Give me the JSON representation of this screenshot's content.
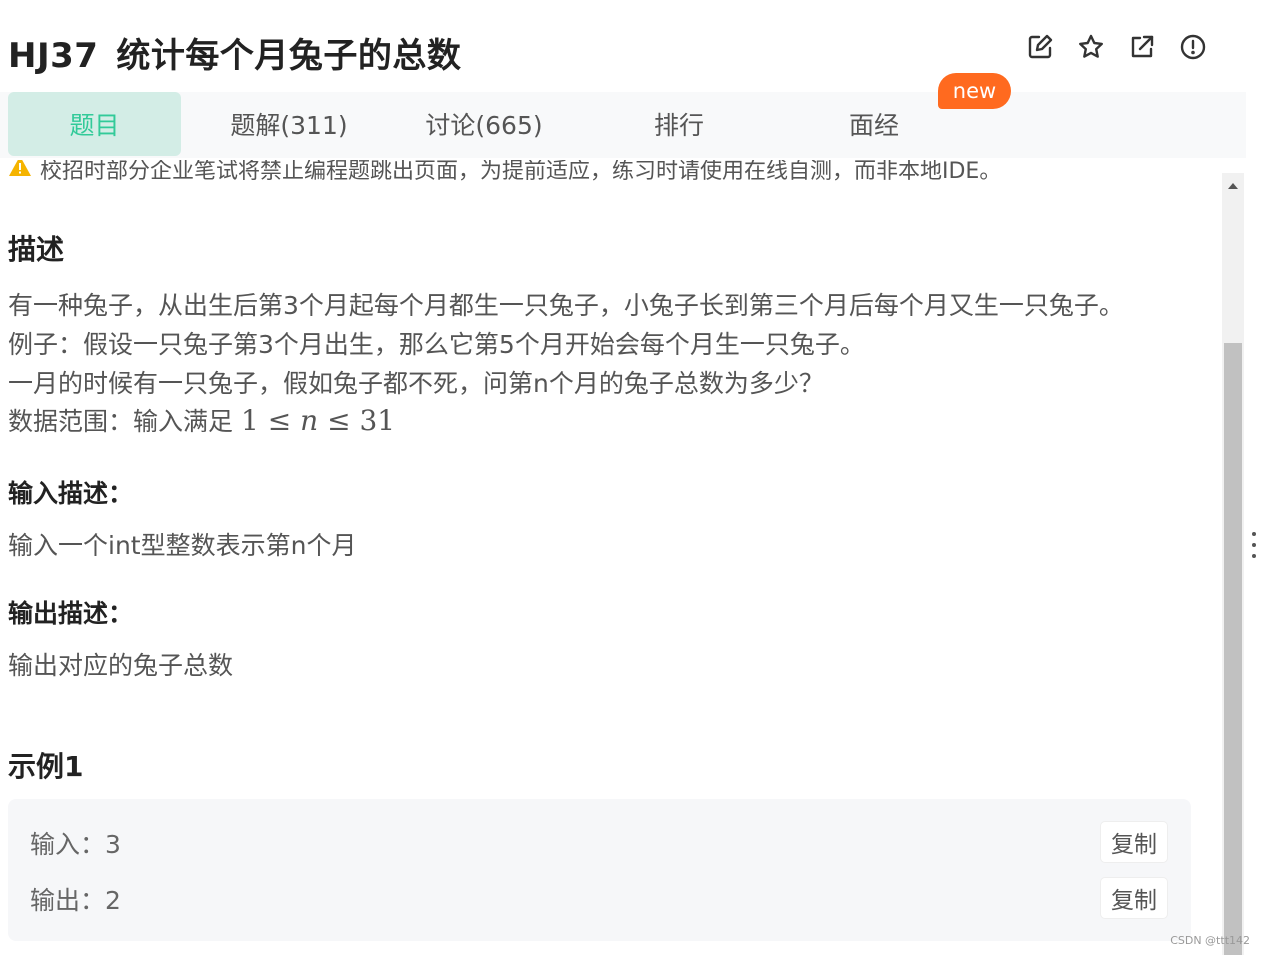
{
  "header": {
    "code": "HJ37",
    "title": "统计每个月兔子的总数",
    "icons": [
      "edit-icon",
      "star-icon",
      "external-link-icon",
      "report-icon"
    ]
  },
  "tabs": [
    {
      "label": "题目",
      "active": true
    },
    {
      "label": "题解(311)",
      "active": false
    },
    {
      "label": "讨论(665)",
      "active": false
    },
    {
      "label": "排行",
      "active": false
    },
    {
      "label": "面经",
      "active": false
    }
  ],
  "new_badge": "new",
  "warning": "校招时部分企业笔试将禁止编程题跳出页面，为提前适应，练习时请使用在线自测，而非本地IDE。",
  "description": {
    "heading": "描述",
    "lines": [
      "有一种兔子，从出生后第3个月起每个月都生一只兔子，小兔子长到第三个月后每个月又生一只兔子。",
      "例子：假设一只兔子第3个月出生，那么它第5个月开始会每个月生一只兔子。",
      "一月的时候有一只兔子，假如兔子都不死，问第n个月的兔子总数为多少？"
    ],
    "range_label": "数据范围：输入满足",
    "range_math_left": "1",
    "range_math_leq1": "≤",
    "range_math_var": "n",
    "range_math_leq2": "≤",
    "range_math_right": "31"
  },
  "input_desc": {
    "heading": "输入描述：",
    "text": "输入一个int型整数表示第n个月"
  },
  "output_desc": {
    "heading": "输出描述：",
    "text": "输出对应的兔子总数"
  },
  "example": {
    "heading": "示例1",
    "input_label": "输入：",
    "input_value": "3",
    "output_label": "输出：",
    "output_value": "2",
    "copy_label": "复制"
  },
  "watermark": "CSDN @ttt142",
  "colors": {
    "accent": "#32ca99",
    "tab_active_bg": "#d3ede6",
    "badge": "#ff6a1f",
    "warning": "#f5b400"
  }
}
